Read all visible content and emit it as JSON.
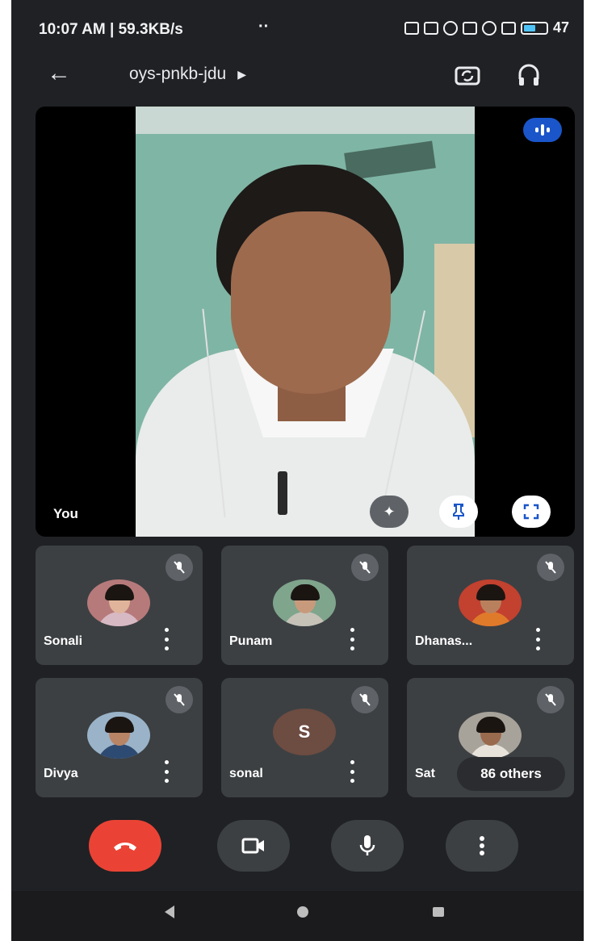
{
  "status_bar": {
    "time_speed": "10:07 AM | 59.3KB/s",
    "dots": "··",
    "battery": "47"
  },
  "app_bar": {
    "meeting_code": "oys-pnkb-jdu"
  },
  "main_video": {
    "self_label": "You"
  },
  "participants": [
    {
      "name": "Sonali"
    },
    {
      "name": "Punam"
    },
    {
      "name": "Dhanas..."
    },
    {
      "name": "Divya"
    },
    {
      "name": "sonal",
      "initial": "S"
    },
    {
      "name": "Sat"
    }
  ],
  "others_badge": "86 others",
  "colors": {
    "background": "#202124",
    "tile": "#3c4043",
    "end_call": "#ea4335",
    "speaking": "#1a56c9"
  }
}
